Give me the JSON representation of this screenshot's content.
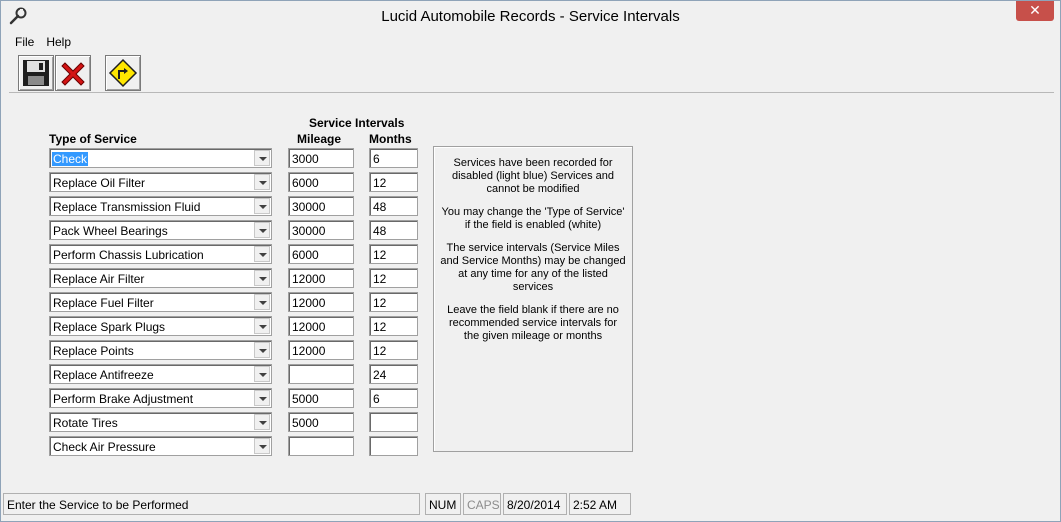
{
  "window": {
    "title": "Lucid Automobile Records - Service Intervals",
    "close_label": "✕"
  },
  "menu": [
    "File",
    "Help"
  ],
  "toolbar": {
    "buttons": [
      "save-icon",
      "delete-icon",
      "return-icon"
    ]
  },
  "form": {
    "group_header": "Service Intervals",
    "col_service": "Type of Service",
    "col_mileage": "Mileage",
    "col_months": "Months",
    "rows": [
      {
        "service": "Check",
        "mileage": "3000",
        "months": "6"
      },
      {
        "service": "Replace Oil Filter",
        "mileage": "6000",
        "months": "12"
      },
      {
        "service": "Replace Transmission Fluid",
        "mileage": "30000",
        "months": "48"
      },
      {
        "service": "Pack Wheel Bearings",
        "mileage": "30000",
        "months": "48"
      },
      {
        "service": "Perform Chassis Lubrication",
        "mileage": "6000",
        "months": "12"
      },
      {
        "service": "Replace Air Filter",
        "mileage": "12000",
        "months": "12"
      },
      {
        "service": "Replace Fuel Filter",
        "mileage": "12000",
        "months": "12"
      },
      {
        "service": "Replace Spark Plugs",
        "mileage": "12000",
        "months": "12"
      },
      {
        "service": "Replace Points",
        "mileage": "12000",
        "months": "12"
      },
      {
        "service": "Replace Antifreeze",
        "mileage": "",
        "months": "24"
      },
      {
        "service": "Perform Brake Adjustment",
        "mileage": "5000",
        "months": "6"
      },
      {
        "service": "Rotate Tires",
        "mileage": "5000",
        "months": ""
      },
      {
        "service": "Check Air Pressure",
        "mileage": "",
        "months": ""
      }
    ]
  },
  "info": [
    "Services have been recorded for disabled (light blue) Services and cannot be modified",
    "You may change the 'Type of Service' if the field is enabled (white)",
    "The service intervals (Service Miles and Service Months) may be changed at any time for any of the listed services",
    "Leave the field blank if there are no recommended service intervals for the given mileage or months"
  ],
  "status": {
    "message": "Enter the Service to be Performed",
    "num": "NUM",
    "caps": "CAPS",
    "date": "8/20/2014",
    "time": "2:52 AM"
  }
}
